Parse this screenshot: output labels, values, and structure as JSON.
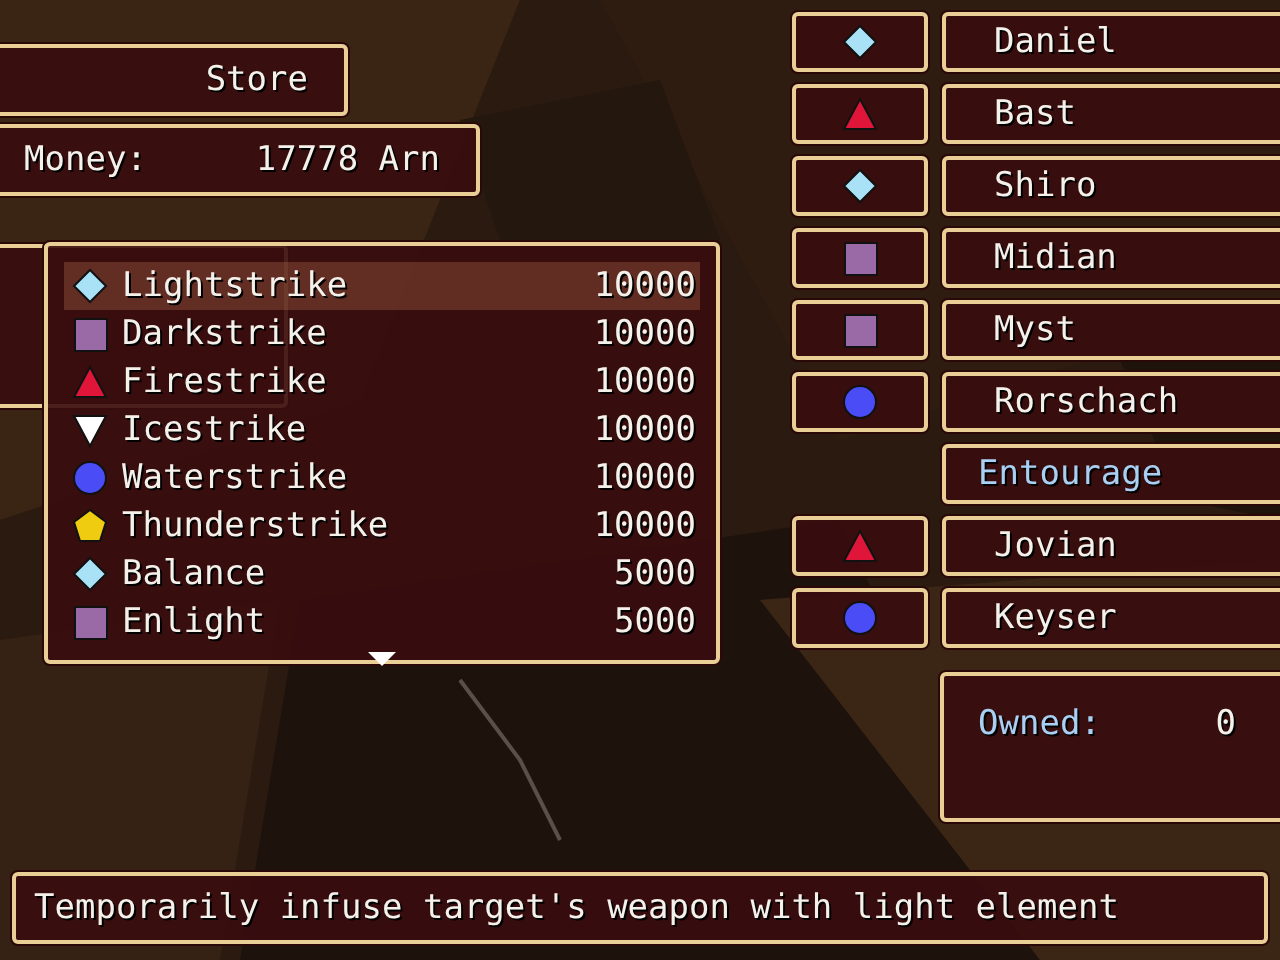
{
  "store": {
    "title": "Store"
  },
  "money": {
    "label": "Money:",
    "value": "17778 Arn"
  },
  "items": [
    {
      "name": "Lightstrike",
      "price": "10000",
      "kind": "diamond",
      "selected": true
    },
    {
      "name": "Darkstrike",
      "price": "10000",
      "kind": "square",
      "selected": false
    },
    {
      "name": "Firestrike",
      "price": "10000",
      "kind": "triangle",
      "selected": false
    },
    {
      "name": "Icestrike",
      "price": "10000",
      "kind": "triangle-down",
      "selected": false
    },
    {
      "name": "Waterstrike",
      "price": "10000",
      "kind": "circle",
      "selected": false
    },
    {
      "name": "Thunderstrike",
      "price": "10000",
      "kind": "pentagon",
      "selected": false
    },
    {
      "name": "Balance",
      "price": "5000",
      "kind": "diamond",
      "selected": false
    },
    {
      "name": "Enlight",
      "price": "5000",
      "kind": "square",
      "selected": false
    }
  ],
  "party": [
    {
      "kind": "diamond",
      "name": "Daniel"
    },
    {
      "kind": "triangle",
      "name": "Bast"
    },
    {
      "kind": "diamond",
      "name": "Shiro"
    },
    {
      "kind": "square",
      "name": "Midian"
    },
    {
      "kind": "square",
      "name": "Myst"
    },
    {
      "kind": "circle",
      "name": "Rorschach"
    },
    {
      "kind": "header",
      "name": "Entourage"
    },
    {
      "kind": "triangle",
      "name": "Jovian"
    },
    {
      "kind": "circle",
      "name": "Keyser"
    }
  ],
  "owned": {
    "label": "Owned:",
    "value": "0"
  },
  "help": {
    "text": "Temporarily infuse target's weapon with light element"
  }
}
